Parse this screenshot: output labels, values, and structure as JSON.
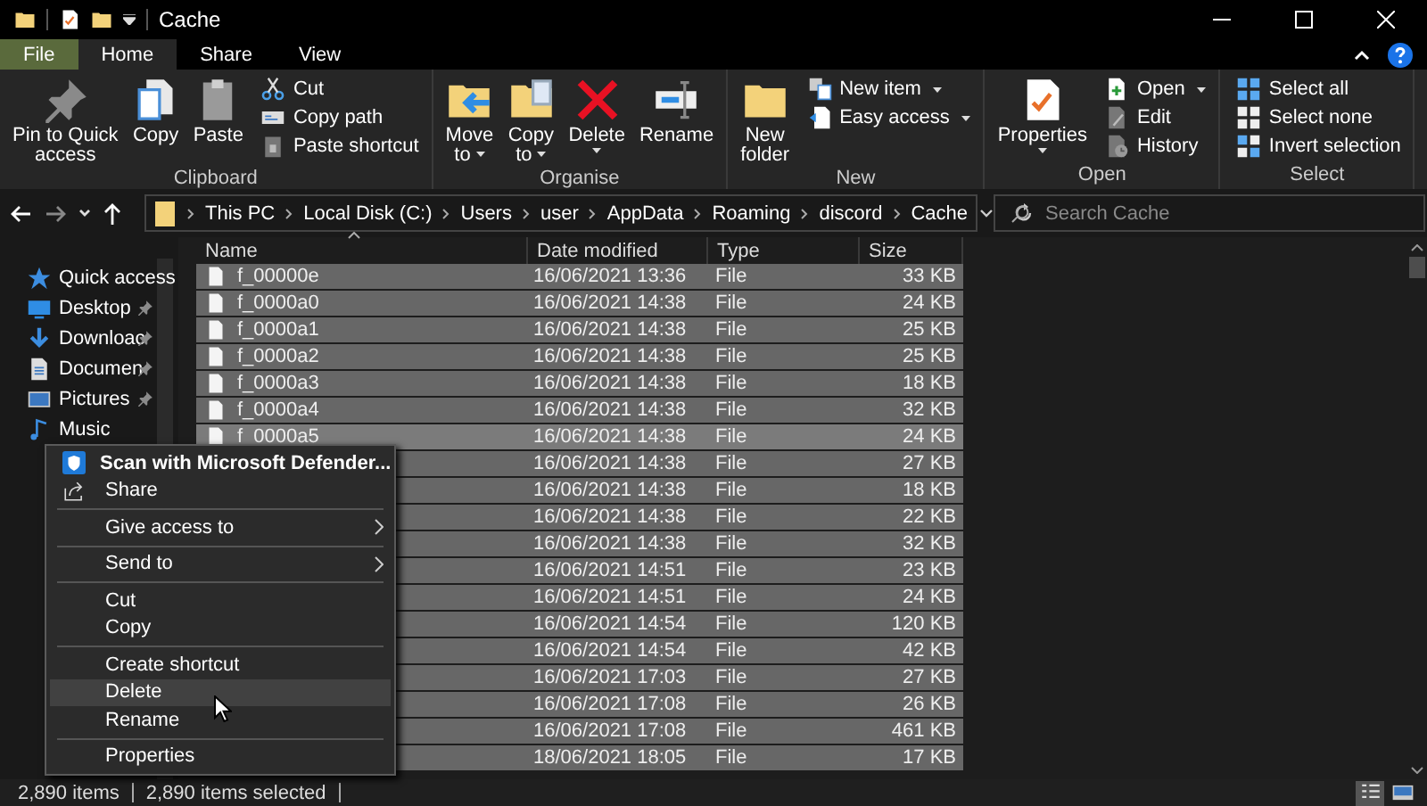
{
  "window": {
    "title": "Cache"
  },
  "ribbon_tabs": [
    {
      "label": "File",
      "kind": "file",
      "selected": false
    },
    {
      "label": "Home",
      "kind": "tab",
      "selected": true
    },
    {
      "label": "Share",
      "kind": "tab",
      "selected": false
    },
    {
      "label": "View",
      "kind": "tab",
      "selected": false
    }
  ],
  "ribbon": {
    "groups": [
      {
        "label": "Clipboard",
        "buttons": [
          {
            "lines": [
              "Pin to Quick",
              "access"
            ],
            "kind": "pin",
            "large": true,
            "dropdown": false
          },
          {
            "lines": [
              "Copy"
            ],
            "kind": "copy",
            "large": true,
            "dropdown": false
          },
          {
            "lines": [
              "Paste"
            ],
            "kind": "paste",
            "large": true,
            "dropdown": false
          },
          {
            "lines": [
              "Cut"
            ],
            "kind": "cut",
            "large": false,
            "dropdown": false
          },
          {
            "lines": [
              "Copy path"
            ],
            "kind": "copypath",
            "large": false,
            "dropdown": false
          },
          {
            "lines": [
              "Paste shortcut"
            ],
            "kind": "pasteshortcut",
            "large": false,
            "dropdown": false
          }
        ]
      },
      {
        "label": "Organise",
        "buttons": [
          {
            "lines": [
              "Move",
              "to"
            ],
            "kind": "moveto",
            "large": true,
            "dropdown": true
          },
          {
            "lines": [
              "Copy",
              "to"
            ],
            "kind": "copyto",
            "large": true,
            "dropdown": true
          },
          {
            "lines": [
              "Delete"
            ],
            "kind": "delete",
            "large": true,
            "dropdown": true
          },
          {
            "lines": [
              "Rename"
            ],
            "kind": "rename",
            "large": true,
            "dropdown": false
          }
        ]
      },
      {
        "label": "New",
        "buttons": [
          {
            "lines": [
              "New",
              "folder"
            ],
            "kind": "newfolder",
            "large": true,
            "dropdown": false
          },
          {
            "lines": [
              "New item"
            ],
            "kind": "newitem",
            "large": false,
            "dropdown": true
          },
          {
            "lines": [
              "Easy access"
            ],
            "kind": "easyaccess",
            "large": false,
            "dropdown": true
          }
        ]
      },
      {
        "label": "Open",
        "buttons": [
          {
            "lines": [
              "Properties"
            ],
            "kind": "properties",
            "large": true,
            "dropdown": true
          },
          {
            "lines": [
              "Open"
            ],
            "kind": "open",
            "large": false,
            "dropdown": true
          },
          {
            "lines": [
              "Edit"
            ],
            "kind": "edit",
            "large": false,
            "dropdown": false
          },
          {
            "lines": [
              "History"
            ],
            "kind": "history",
            "large": false,
            "dropdown": false
          }
        ]
      },
      {
        "label": "Select",
        "buttons": [
          {
            "lines": [
              "Select all"
            ],
            "kind": "selectall",
            "large": false,
            "dropdown": false
          },
          {
            "lines": [
              "Select none"
            ],
            "kind": "selectnone",
            "large": false,
            "dropdown": false
          },
          {
            "lines": [
              "Invert selection"
            ],
            "kind": "invert",
            "large": false,
            "dropdown": false
          }
        ]
      }
    ]
  },
  "address": {
    "breadcrumbs": [
      "This PC",
      "Local Disk (C:)",
      "Users",
      "user",
      "AppData",
      "Roaming",
      "discord",
      "Cache"
    ],
    "search": {
      "placeholder": "Search Cache"
    }
  },
  "nav_pane": {
    "items": [
      {
        "label": "Quick access",
        "kind": "star",
        "pinned": false
      },
      {
        "label": "Desktop",
        "kind": "desktop",
        "pinned": true
      },
      {
        "label": "Downloac",
        "kind": "download",
        "pinned": true
      },
      {
        "label": "Documen",
        "kind": "documents",
        "pinned": true
      },
      {
        "label": "Pictures",
        "kind": "pictures",
        "pinned": true
      },
      {
        "label": "Music",
        "kind": "music",
        "pinned": false
      }
    ]
  },
  "columns": [
    {
      "label": "Name",
      "sorted": true
    },
    {
      "label": "Date modified",
      "sorted": false
    },
    {
      "label": "Type",
      "sorted": false
    },
    {
      "label": "Size",
      "sorted": false
    }
  ],
  "rows": [
    {
      "name": "f_00000e",
      "date_modified": "16/06/2021 13:36",
      "type": "File",
      "size": "33 KB",
      "selected": true,
      "hovered": false
    },
    {
      "name": "f_0000a0",
      "date_modified": "16/06/2021 14:38",
      "type": "File",
      "size": "24 KB",
      "selected": true,
      "hovered": false
    },
    {
      "name": "f_0000a1",
      "date_modified": "16/06/2021 14:38",
      "type": "File",
      "size": "25 KB",
      "selected": true,
      "hovered": false
    },
    {
      "name": "f_0000a2",
      "date_modified": "16/06/2021 14:38",
      "type": "File",
      "size": "25 KB",
      "selected": true,
      "hovered": false
    },
    {
      "name": "f_0000a3",
      "date_modified": "16/06/2021 14:38",
      "type": "File",
      "size": "18 KB",
      "selected": true,
      "hovered": false
    },
    {
      "name": "f_0000a4",
      "date_modified": "16/06/2021 14:38",
      "type": "File",
      "size": "32 KB",
      "selected": true,
      "hovered": false
    },
    {
      "name": "f_0000a5",
      "date_modified": "16/06/2021 14:38",
      "type": "File",
      "size": "24 KB",
      "selected": true,
      "hovered": true
    },
    {
      "date_modified": "16/06/2021 14:38",
      "type": "File",
      "size": "27 KB",
      "selected": true,
      "hovered": false
    },
    {
      "date_modified": "16/06/2021 14:38",
      "type": "File",
      "size": "18 KB",
      "selected": true,
      "hovered": false
    },
    {
      "date_modified": "16/06/2021 14:38",
      "type": "File",
      "size": "22 KB",
      "selected": true,
      "hovered": false
    },
    {
      "date_modified": "16/06/2021 14:38",
      "type": "File",
      "size": "32 KB",
      "selected": true,
      "hovered": false
    },
    {
      "date_modified": "16/06/2021 14:51",
      "type": "File",
      "size": "23 KB",
      "selected": true,
      "hovered": false
    },
    {
      "date_modified": "16/06/2021 14:51",
      "type": "File",
      "size": "24 KB",
      "selected": true,
      "hovered": false
    },
    {
      "date_modified": "16/06/2021 14:54",
      "type": "File",
      "size": "120 KB",
      "selected": true,
      "hovered": false
    },
    {
      "date_modified": "16/06/2021 14:54",
      "type": "File",
      "size": "42 KB",
      "selected": true,
      "hovered": false
    },
    {
      "date_modified": "16/06/2021 17:03",
      "type": "File",
      "size": "27 KB",
      "selected": true,
      "hovered": false
    },
    {
      "date_modified": "16/06/2021 17:08",
      "type": "File",
      "size": "26 KB",
      "selected": true,
      "hovered": false
    },
    {
      "date_modified": "16/06/2021 17:08",
      "type": "File",
      "size": "461 KB",
      "selected": true,
      "hovered": false
    },
    {
      "date_modified": "18/06/2021 18:05",
      "type": "File",
      "size": "17 KB",
      "selected": true,
      "hovered": false
    }
  ],
  "context_menu": {
    "items": [
      {
        "kind": "scan",
        "label": "Scan with Microsoft Defender...",
        "selected": false
      },
      {
        "kind": "share",
        "label": "Share",
        "selected": false
      },
      {
        "kind": "separator"
      },
      {
        "kind": "submenu",
        "label": "Give access to",
        "selected": false
      },
      {
        "kind": "separator"
      },
      {
        "kind": "submenu",
        "label": "Send to",
        "selected": false
      },
      {
        "kind": "separator"
      },
      {
        "kind": "plain",
        "label": "Cut",
        "selected": false
      },
      {
        "kind": "plain",
        "label": "Copy",
        "selected": false
      },
      {
        "kind": "separator"
      },
      {
        "kind": "plain",
        "label": "Create shortcut",
        "selected": false
      },
      {
        "kind": "plain",
        "label": "Delete",
        "selected": true
      },
      {
        "kind": "plain",
        "label": "Rename",
        "selected": false
      },
      {
        "kind": "separator"
      },
      {
        "kind": "plain",
        "label": "Properties",
        "selected": false
      }
    ]
  },
  "status_bar": {
    "item_count": "2,890 items",
    "selection": "2,890 items selected",
    "views": [
      {
        "kind": "details",
        "selected": true
      },
      {
        "kind": "large_icons",
        "selected": false
      }
    ]
  }
}
